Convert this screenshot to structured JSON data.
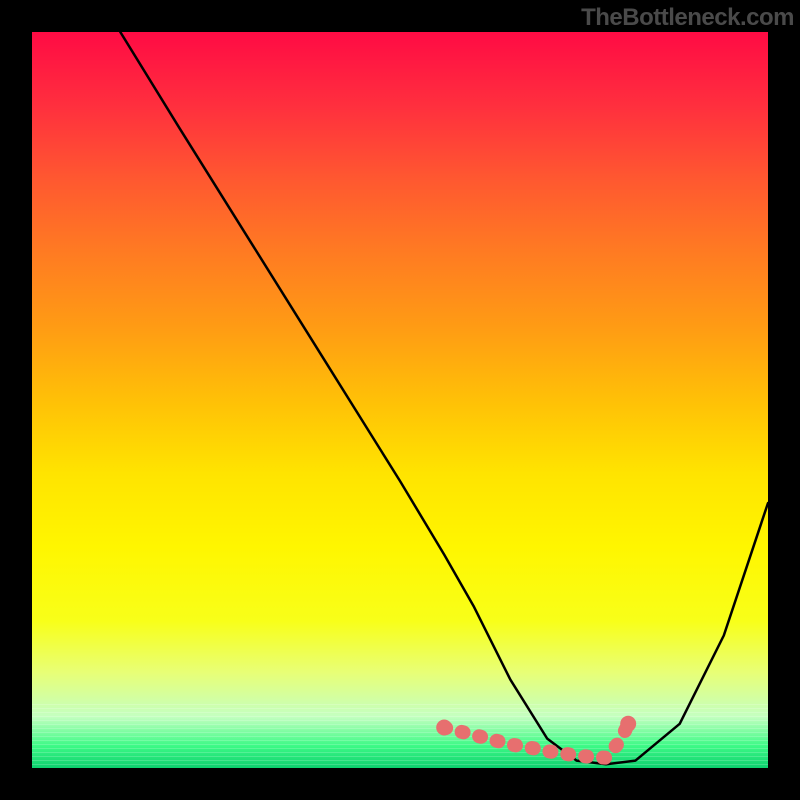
{
  "watermark": "TheBottleneck.com",
  "colors": {
    "curve": "#000000",
    "marker": "#e76f6f",
    "bg_top": "#ff0b44",
    "bg_bottom": "#0dcf6e"
  },
  "chart_data": {
    "type": "line",
    "title": "",
    "xlabel": "",
    "ylabel": "",
    "xlim": [
      0,
      100
    ],
    "ylim": [
      0,
      100
    ],
    "grid": false,
    "legend": false,
    "series": [
      {
        "name": "bottleneck-curve",
        "x": [
          12,
          20,
          30,
          40,
          50,
          56,
          60,
          65,
          70,
          74,
          78,
          82,
          88,
          94,
          100
        ],
        "values": [
          100,
          87,
          71,
          55,
          39,
          29,
          22,
          12,
          4,
          1,
          0.5,
          1,
          6,
          18,
          36
        ]
      }
    ],
    "markers": {
      "name": "highlighted-floor",
      "x": [
        56,
        58,
        60,
        62,
        65,
        68,
        70,
        72,
        74,
        76,
        78,
        80,
        81
      ],
      "values": [
        5.5,
        5,
        4.5,
        4,
        3.2,
        2.7,
        2.3,
        2,
        1.7,
        1.5,
        1.4,
        3.8,
        6
      ],
      "style": "thick-pink"
    }
  }
}
